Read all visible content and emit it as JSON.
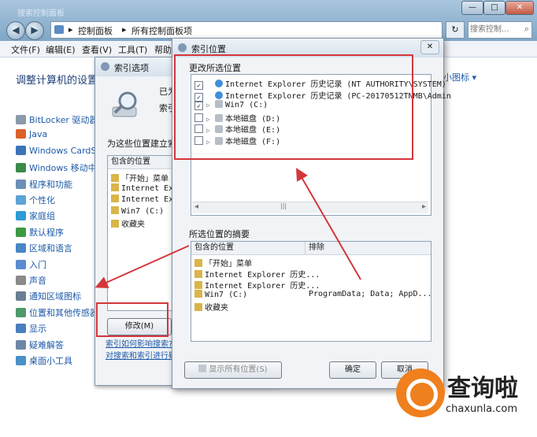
{
  "window": {
    "title": "搜索控制面板",
    "minimize_label": "—",
    "maximize_label": "□",
    "close_label": "✕"
  },
  "address": {
    "back_label": "◀",
    "forward_label": "▶",
    "crumb_root": "控制面板",
    "crumb_sep": "▸",
    "crumb_current": "所有控制面板项",
    "refresh_label": "↻",
    "search_placeholder": "搜索控制..."
  },
  "menu": [
    "文件(F)",
    "编辑(E)",
    "查看(V)",
    "工具(T)",
    "帮助(H)"
  ],
  "main": {
    "heading": "调整计算机的设置",
    "view_mode": "小图标 ▾",
    "items": [
      {
        "label": "BitLocker 驱动器加",
        "color": "#8a9aa8"
      },
      {
        "label": "Java",
        "color": "#d9622b"
      },
      {
        "label": "Windows CardSp",
        "color": "#3b73b8"
      },
      {
        "label": "Windows 移动中心",
        "color": "#3a8a4a"
      },
      {
        "label": "程序和功能",
        "color": "#6b8fb5"
      },
      {
        "label": "个性化",
        "color": "#5da3d6"
      },
      {
        "label": "家庭组",
        "color": "#2f9bd6"
      },
      {
        "label": "默认程序",
        "color": "#3d9a42"
      },
      {
        "label": "区域和语言",
        "color": "#4a86c5"
      },
      {
        "label": "入门",
        "color": "#5b8bd1"
      },
      {
        "label": "声音",
        "color": "#8a8a8a"
      },
      {
        "label": "通知区域图标",
        "color": "#6a7f95"
      },
      {
        "label": "位置和其他传感器",
        "color": "#4d9a6a"
      },
      {
        "label": "显示",
        "color": "#4a7fbf"
      },
      {
        "label": "疑难解答",
        "color": "#6c87a6"
      },
      {
        "label": "桌面小工具",
        "color": "#4a90c9"
      }
    ]
  },
  "index_options": {
    "title": "索引选项",
    "status_line1": "已为",
    "status_line2": "索引",
    "locations_caption": "为这些位置建立索引",
    "included_header": "包含的位置",
    "included": [
      "「开始」菜单",
      "Internet Explo",
      "Internet Explo",
      "Win7 (C:)",
      "收藏夹"
    ],
    "modify_button": "修改(M)",
    "link1": "索引如何影响搜索?",
    "link2": "对搜索和索引进行疑"
  },
  "index_locations": {
    "title": "索引位置",
    "close_label": "✕",
    "change_caption": "更改所选位置",
    "tree": [
      {
        "checked": true,
        "expander": "",
        "label": "Internet Explorer 历史记录 (NT AUTHORITY\\SYSTEM)"
      },
      {
        "checked": true,
        "expander": "",
        "label": "Internet Explorer 历史记录 (PC-20170512TNMB\\Admin"
      },
      {
        "checked": true,
        "expander": "▷",
        "label": "Win7 (C:)"
      },
      {
        "checked": false,
        "expander": "▷",
        "label": "本地磁盘 (D:)"
      },
      {
        "checked": false,
        "expander": "▷",
        "label": "本地磁盘 (E:)"
      },
      {
        "checked": false,
        "expander": "▷",
        "label": "本地磁盘 (F:)"
      }
    ],
    "scroll_left": "◂",
    "scroll_thumb": "|||",
    "scroll_right": "▸",
    "summary_caption": "所选位置的摘要",
    "summary_col1": "包含的位置",
    "summary_col2": "排除",
    "summary_rows": [
      {
        "label": "「开始」菜单",
        "exclude": ""
      },
      {
        "label": "Internet Explorer 历史...",
        "exclude": ""
      },
      {
        "label": "Internet Explorer 历史...",
        "exclude": ""
      },
      {
        "label": "Win7 (C:)",
        "exclude": "ProgramData; Data; AppD..."
      },
      {
        "label": "收藏夹",
        "exclude": ""
      }
    ],
    "show_all_button": "显示所有位置(S)",
    "ok_button": "确定",
    "cancel_button": "取消"
  },
  "watermark": {
    "brand": "查询啦",
    "url": "chaxunla.com"
  },
  "colors": {
    "annotation_red": "#d4363c",
    "link_blue": "#1e5aa8",
    "watermark_orange": "#f07f1e"
  }
}
